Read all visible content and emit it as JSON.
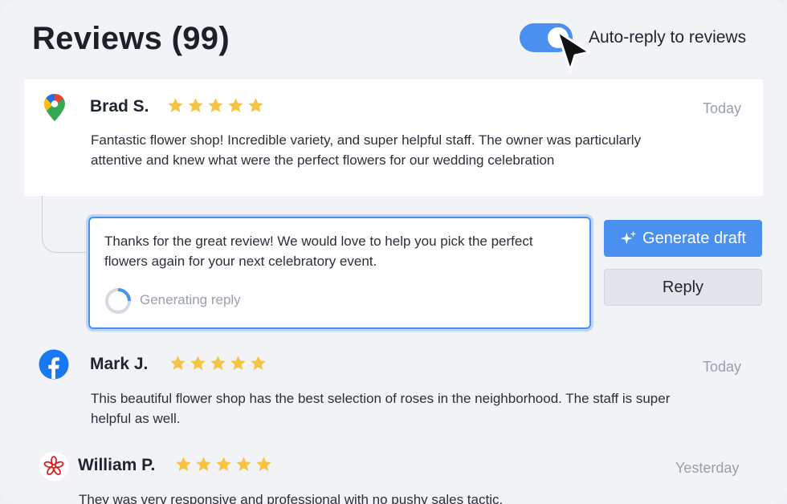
{
  "header": {
    "title": "Reviews (99)",
    "auto_reply_label": "Auto-reply to reviews",
    "auto_reply_enabled": true
  },
  "reviews": [
    {
      "source_icon": "google-maps-icon",
      "name": "Brad S.",
      "rating": 5,
      "date": "Today",
      "text_line1": "Fantastic flower shop! Incredible variety, and super helpful staff.  The owner was particularly",
      "text_line2": "attentive and knew what were the  perfect flowers for our wedding celebration"
    },
    {
      "source_icon": "facebook-icon",
      "name": "Mark J.",
      "rating": 5,
      "date": "Today",
      "text_line1": "This beautiful flower shop has the best selection of roses in the neighborhood. The staff is super",
      "text_line2": "helpful as well."
    },
    {
      "source_icon": "yelp-icon",
      "name": "William P.",
      "rating": 5,
      "date": "Yesterday",
      "text_line1": "They was very responsive and professional with no pushy sales tactic."
    }
  ],
  "reply": {
    "draft_line1": "Thanks for the great review! We would love to help you pick the perfect",
    "draft_line2": "flowers again for your next celebratory event.",
    "status": "Generating reply",
    "generate_label": "Generate draft",
    "reply_label": "Reply"
  },
  "colors": {
    "accent": "#4a90f0",
    "star": "#f6c343",
    "facebook": "#1877f2",
    "yelp": "#d32323"
  }
}
